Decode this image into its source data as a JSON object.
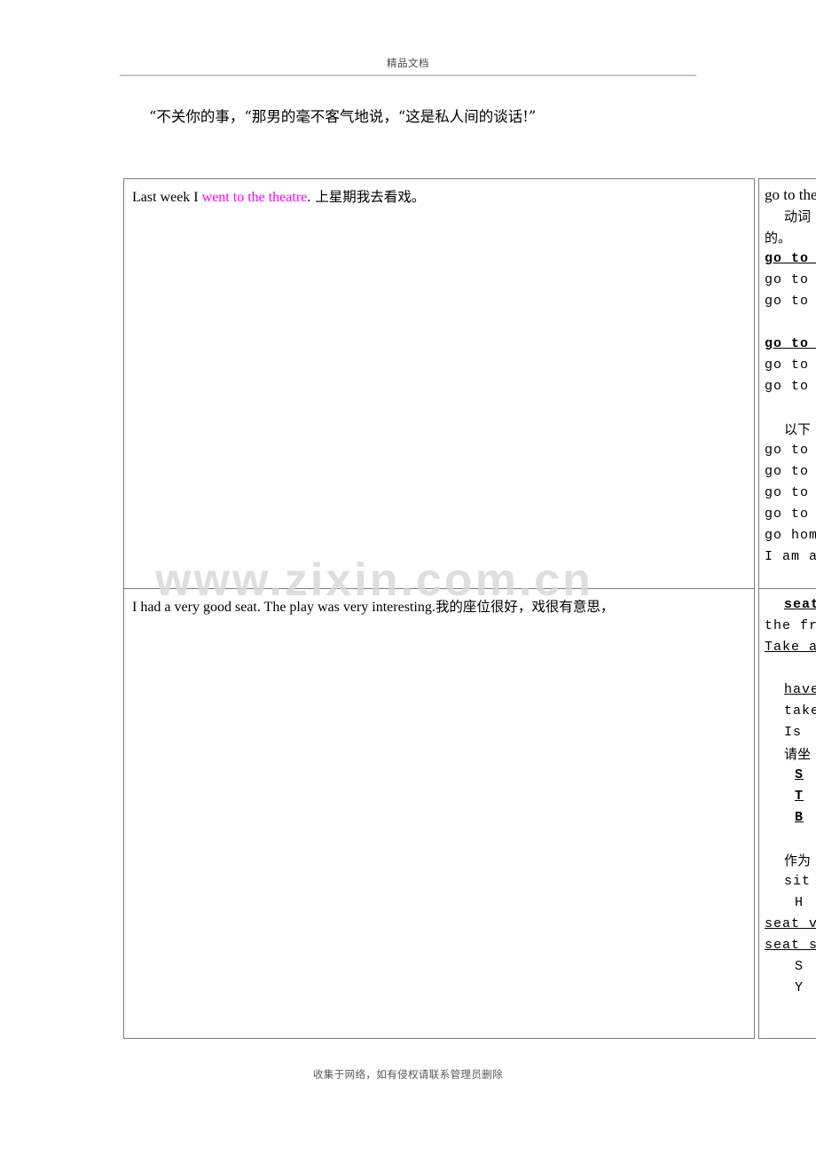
{
  "page": {
    "header_text": "精品文档",
    "footer_text": "收集于网络，如有侵权请联系管理员删除",
    "watermark": "www.zixin.com.cn",
    "intro_paragraph": "“不关你的事，“那男的毫不客气地说，“这是私人间的谈话!”"
  },
  "table": {
    "rows": [
      {
        "english_before": "Last week I ",
        "english_highlight": "went to the theatre",
        "english_after": ".",
        "chinese": " 上星期我去看戏。"
      },
      {
        "english_before": "I had a very good seat. The play was very interesting.",
        "english_highlight": "",
        "english_after": "",
        "chinese": "我的座位很好，戏很有意思，"
      }
    ]
  },
  "side_column": {
    "row1_lines": [
      {
        "text": "go to the theatre",
        "style": "serif",
        "indent": 0,
        "bold": false,
        "underline": false
      },
      {
        "text": "动词",
        "style": "cn",
        "indent": 1,
        "bold": false,
        "underline": false
      },
      {
        "text": "的。",
        "style": "cn",
        "indent": 0,
        "bold": false,
        "underline": false
      },
      {
        "text": "go to the",
        "style": "mono",
        "indent": 0,
        "bold": true,
        "underline": true
      },
      {
        "text": "go to the",
        "style": "mono",
        "indent": 0,
        "bold": false,
        "underline": false
      },
      {
        "text": "go to the",
        "style": "mono",
        "indent": 0,
        "bold": false,
        "underline": false
      },
      {
        "text": "",
        "style": "blank",
        "indent": 0,
        "bold": false,
        "underline": false
      },
      {
        "text": "go to the",
        "style": "mono",
        "indent": 0,
        "bold": true,
        "underline": true
      },
      {
        "text": "go to the",
        "style": "mono",
        "indent": 0,
        "bold": false,
        "underline": false
      },
      {
        "text": "go to the",
        "style": "mono",
        "indent": 0,
        "bold": false,
        "underline": false
      },
      {
        "text": "",
        "style": "blank",
        "indent": 0,
        "bold": false,
        "underline": false
      },
      {
        "text": "以下",
        "style": "cn",
        "indent": 1,
        "bold": false,
        "underline": false
      },
      {
        "text": "go to school",
        "style": "mono",
        "indent": 0,
        "bold": false,
        "underline": false
      },
      {
        "text": "go to church",
        "style": "mono",
        "indent": 0,
        "bold": false,
        "underline": false
      },
      {
        "text": "go to hospital",
        "style": "mono",
        "indent": 0,
        "bold": false,
        "underline": false
      },
      {
        "text": "go to bed",
        "style": "mono",
        "indent": 0,
        "bold": false,
        "underline": false
      },
      {
        "text": "go home",
        "style": "mono",
        "indent": 0,
        "bold": false,
        "underline": false
      },
      {
        "text": "I am at",
        "style": "mono",
        "indent": 0,
        "bold": false,
        "underline": false
      }
    ],
    "row2_lines": [
      {
        "text": "seat",
        "style": "mono",
        "indent": 1,
        "bold": true,
        "underline": true
      },
      {
        "text": "the front",
        "style": "mono",
        "indent": 0,
        "bold": false,
        "underline": false
      },
      {
        "text": "Take a seat",
        "style": "mono",
        "indent": 0,
        "bold": false,
        "underline": true
      },
      {
        "text": "",
        "style": "blank",
        "indent": 0,
        "bold": false,
        "underline": false
      },
      {
        "text": "have a",
        "style": "mono",
        "indent": 1,
        "bold": false,
        "underline": true
      },
      {
        "text": "take a",
        "style": "mono",
        "indent": 1,
        "bold": false,
        "underline": false
      },
      {
        "text": "Is",
        "style": "mono",
        "indent": 1,
        "bold": false,
        "underline": false
      },
      {
        "text": "请坐",
        "style": "cn",
        "indent": 1,
        "bold": false,
        "underline": false
      },
      {
        "text": "S",
        "style": "mono",
        "indent": 2,
        "bold": true,
        "underline": true
      },
      {
        "text": "T",
        "style": "mono",
        "indent": 2,
        "bold": true,
        "underline": true
      },
      {
        "text": "B",
        "style": "mono",
        "indent": 2,
        "bold": true,
        "underline": true
      },
      {
        "text": "",
        "style": "blank",
        "indent": 0,
        "bold": false,
        "underline": false
      },
      {
        "text": "作为",
        "style": "cn",
        "indent": 1,
        "bold": false,
        "underline": false
      },
      {
        "text": "sit",
        "style": "mono",
        "indent": 1,
        "bold": false,
        "underline": false
      },
      {
        "text": "H",
        "style": "mono",
        "indent": 2,
        "bold": false,
        "underline": false
      },
      {
        "text": "seat  v",
        "style": "mono",
        "indent": 0,
        "bold": false,
        "underline": true
      },
      {
        "text": "seat shut",
        "style": "mono",
        "indent": 0,
        "bold": false,
        "underline": true
      },
      {
        "text": "S",
        "style": "mono",
        "indent": 2,
        "bold": false,
        "underline": false
      },
      {
        "text": "Y",
        "style": "mono",
        "indent": 2,
        "bold": false,
        "underline": false
      }
    ]
  }
}
